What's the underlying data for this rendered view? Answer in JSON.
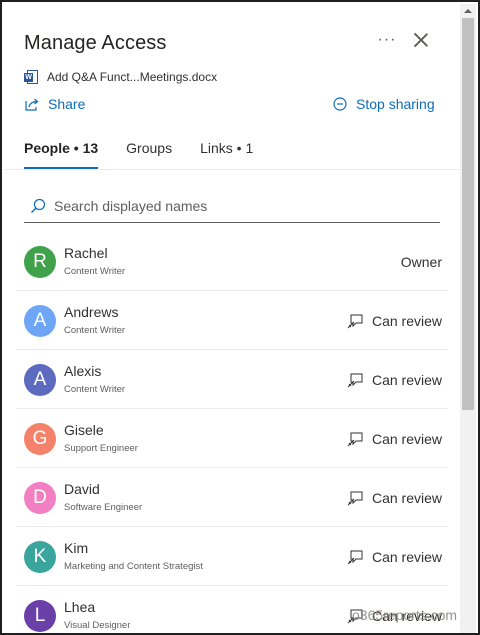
{
  "panel": {
    "title": "Manage Access",
    "more_label": "···",
    "file_name": "Add Q&A Funct...Meetings.docx",
    "file_icon": "word-doc-icon",
    "share_label": "Share",
    "stop_sharing_label": "Stop sharing"
  },
  "tabs": [
    {
      "label": "People • 13",
      "active": true
    },
    {
      "label": "Groups",
      "active": false
    },
    {
      "label": "Links • 1",
      "active": false
    }
  ],
  "search": {
    "placeholder": "Search displayed names",
    "value": ""
  },
  "people": [
    {
      "initial": "R",
      "name": "Rachel",
      "role": "Content Writer",
      "permission": "Owner",
      "color": "#3fa14a"
    },
    {
      "initial": "A",
      "name": "Andrews",
      "role": "Content Writer",
      "permission": "Can review",
      "color": "#6ea6f5"
    },
    {
      "initial": "A",
      "name": "Alexis",
      "role": "Content Writer",
      "permission": "Can review",
      "color": "#5c6bc0"
    },
    {
      "initial": "G",
      "name": "Gisele",
      "role": "Support Engineer",
      "permission": "Can review",
      "color": "#f4816a"
    },
    {
      "initial": "D",
      "name": "David",
      "role": "Software Engineer",
      "permission": "Can review",
      "color": "#f27fc1"
    },
    {
      "initial": "K",
      "name": "Kim",
      "role": "Marketing and Content Strategist",
      "permission": "Can review",
      "color": "#3aa59d"
    },
    {
      "initial": "L",
      "name": "Lhea",
      "role": "Visual Designer",
      "permission": "Can review",
      "color": "#6b3fa8"
    }
  ],
  "watermark": "o365reports.com",
  "colors": {
    "accent": "#0f6cbd",
    "text": "#323130",
    "divider": "#edebe9"
  }
}
